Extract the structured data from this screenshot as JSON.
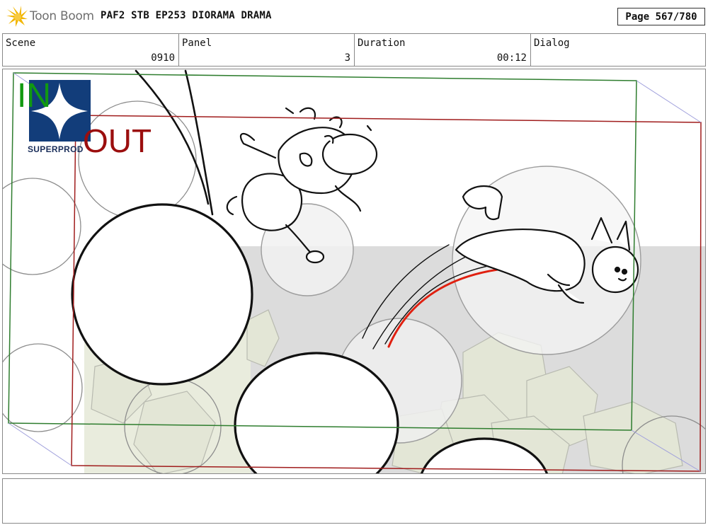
{
  "app": {
    "brand_name": "Toon Boom",
    "accent_color": "#f0b400"
  },
  "header": {
    "project_title": "PAF2 STB EP253 DIORAMA DRAMA",
    "page_indicator": "Page 567/780"
  },
  "info": {
    "scene_label": "Scene",
    "scene_value": "0910",
    "panel_label": "Panel",
    "panel_value": "3",
    "duration_label": "Duration",
    "duration_value": "00:12",
    "dialog_label": "Dialog",
    "dialog_value": ""
  },
  "panel": {
    "in_label": "IN",
    "out_label": "OUT",
    "studio_logo_text": "SUPERPROD",
    "in_frame_color": "#2e7d2e",
    "out_frame_color": "#a01c1c",
    "motion_line_color": "#e02010"
  },
  "notes": {
    "text": ""
  }
}
